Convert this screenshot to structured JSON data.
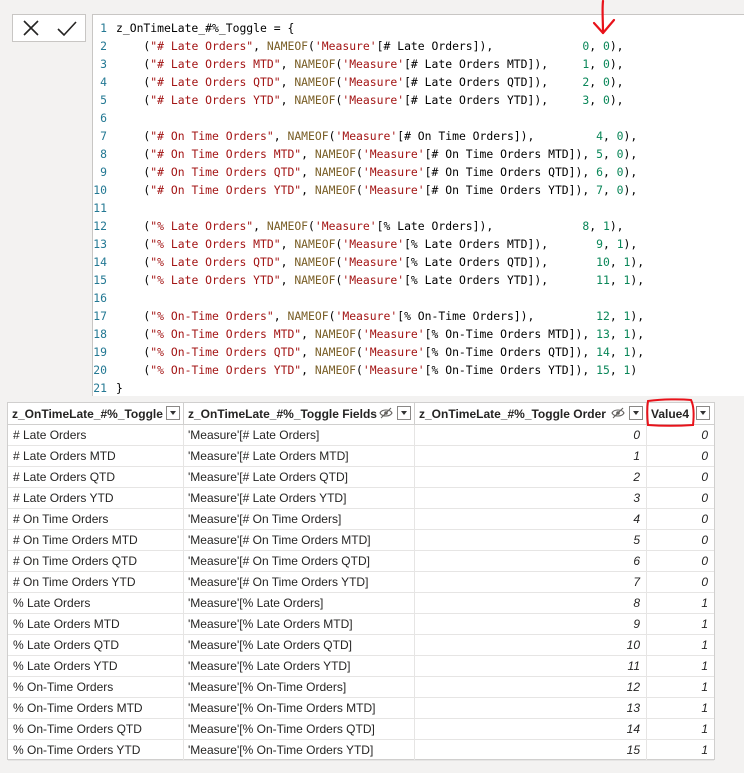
{
  "editor": {
    "lines": [
      {
        "n": "1",
        "segs": [
          [
            "kw",
            "z_OnTimeLate_#%_Toggle = {"
          ]
        ]
      },
      {
        "n": "2",
        "segs": [
          [
            "kw",
            "    ("
          ],
          [
            "str",
            "\"# Late Orders\""
          ],
          [
            "kw",
            ", "
          ],
          [
            "fn",
            "NAMEOF"
          ],
          [
            "kw",
            "("
          ],
          [
            "str",
            "'Measure'"
          ],
          [
            "kw",
            "[# Late Orders]),             "
          ],
          [
            "num",
            "0"
          ],
          [
            "kw",
            ", "
          ],
          [
            "num",
            "0"
          ],
          [
            "kw",
            "),"
          ]
        ]
      },
      {
        "n": "3",
        "segs": [
          [
            "kw",
            "    ("
          ],
          [
            "str",
            "\"# Late Orders MTD\""
          ],
          [
            "kw",
            ", "
          ],
          [
            "fn",
            "NAMEOF"
          ],
          [
            "kw",
            "("
          ],
          [
            "str",
            "'Measure'"
          ],
          [
            "kw",
            "[# Late Orders MTD]),     "
          ],
          [
            "num",
            "1"
          ],
          [
            "kw",
            ", "
          ],
          [
            "num",
            "0"
          ],
          [
            "kw",
            "),"
          ]
        ]
      },
      {
        "n": "4",
        "segs": [
          [
            "kw",
            "    ("
          ],
          [
            "str",
            "\"# Late Orders QTD\""
          ],
          [
            "kw",
            ", "
          ],
          [
            "fn",
            "NAMEOF"
          ],
          [
            "kw",
            "("
          ],
          [
            "str",
            "'Measure'"
          ],
          [
            "kw",
            "[# Late Orders QTD]),     "
          ],
          [
            "num",
            "2"
          ],
          [
            "kw",
            ", "
          ],
          [
            "num",
            "0"
          ],
          [
            "kw",
            "),"
          ]
        ]
      },
      {
        "n": "5",
        "segs": [
          [
            "kw",
            "    ("
          ],
          [
            "str",
            "\"# Late Orders YTD\""
          ],
          [
            "kw",
            ", "
          ],
          [
            "fn",
            "NAMEOF"
          ],
          [
            "kw",
            "("
          ],
          [
            "str",
            "'Measure'"
          ],
          [
            "kw",
            "[# Late Orders YTD]),     "
          ],
          [
            "num",
            "3"
          ],
          [
            "kw",
            ", "
          ],
          [
            "num",
            "0"
          ],
          [
            "kw",
            "),"
          ]
        ]
      },
      {
        "n": "6",
        "segs": []
      },
      {
        "n": "7",
        "segs": [
          [
            "kw",
            "    ("
          ],
          [
            "str",
            "\"# On Time Orders\""
          ],
          [
            "kw",
            ", "
          ],
          [
            "fn",
            "NAMEOF"
          ],
          [
            "kw",
            "("
          ],
          [
            "str",
            "'Measure'"
          ],
          [
            "kw",
            "[# On Time Orders]),         "
          ],
          [
            "num",
            "4"
          ],
          [
            "kw",
            ", "
          ],
          [
            "num",
            "0"
          ],
          [
            "kw",
            "),"
          ]
        ]
      },
      {
        "n": "8",
        "segs": [
          [
            "kw",
            "    ("
          ],
          [
            "str",
            "\"# On Time Orders MTD\""
          ],
          [
            "kw",
            ", "
          ],
          [
            "fn",
            "NAMEOF"
          ],
          [
            "kw",
            "("
          ],
          [
            "str",
            "'Measure'"
          ],
          [
            "kw",
            "[# On Time Orders MTD]), "
          ],
          [
            "num",
            "5"
          ],
          [
            "kw",
            ", "
          ],
          [
            "num",
            "0"
          ],
          [
            "kw",
            "),"
          ]
        ]
      },
      {
        "n": "9",
        "segs": [
          [
            "kw",
            "    ("
          ],
          [
            "str",
            "\"# On Time Orders QTD\""
          ],
          [
            "kw",
            ", "
          ],
          [
            "fn",
            "NAMEOF"
          ],
          [
            "kw",
            "("
          ],
          [
            "str",
            "'Measure'"
          ],
          [
            "kw",
            "[# On Time Orders QTD]), "
          ],
          [
            "num",
            "6"
          ],
          [
            "kw",
            ", "
          ],
          [
            "num",
            "0"
          ],
          [
            "kw",
            "),"
          ]
        ]
      },
      {
        "n": "10",
        "segs": [
          [
            "kw",
            "    ("
          ],
          [
            "str",
            "\"# On Time Orders YTD\""
          ],
          [
            "kw",
            ", "
          ],
          [
            "fn",
            "NAMEOF"
          ],
          [
            "kw",
            "("
          ],
          [
            "str",
            "'Measure'"
          ],
          [
            "kw",
            "[# On Time Orders YTD]), "
          ],
          [
            "num",
            "7"
          ],
          [
            "kw",
            ", "
          ],
          [
            "num",
            "0"
          ],
          [
            "kw",
            "),"
          ]
        ]
      },
      {
        "n": "11",
        "segs": []
      },
      {
        "n": "12",
        "segs": [
          [
            "kw",
            "    ("
          ],
          [
            "str",
            "\"% Late Orders\""
          ],
          [
            "kw",
            ", "
          ],
          [
            "fn",
            "NAMEOF"
          ],
          [
            "kw",
            "("
          ],
          [
            "str",
            "'Measure'"
          ],
          [
            "kw",
            "[% Late Orders]),             "
          ],
          [
            "num",
            "8"
          ],
          [
            "kw",
            ", "
          ],
          [
            "num",
            "1"
          ],
          [
            "kw",
            "),"
          ]
        ]
      },
      {
        "n": "13",
        "segs": [
          [
            "kw",
            "    ("
          ],
          [
            "str",
            "\"% Late Orders MTD\""
          ],
          [
            "kw",
            ", "
          ],
          [
            "fn",
            "NAMEOF"
          ],
          [
            "kw",
            "("
          ],
          [
            "str",
            "'Measure'"
          ],
          [
            "kw",
            "[% Late Orders MTD]),       "
          ],
          [
            "num",
            "9"
          ],
          [
            "kw",
            ", "
          ],
          [
            "num",
            "1"
          ],
          [
            "kw",
            "),"
          ]
        ]
      },
      {
        "n": "14",
        "segs": [
          [
            "kw",
            "    ("
          ],
          [
            "str",
            "\"% Late Orders QTD\""
          ],
          [
            "kw",
            ", "
          ],
          [
            "fn",
            "NAMEOF"
          ],
          [
            "kw",
            "("
          ],
          [
            "str",
            "'Measure'"
          ],
          [
            "kw",
            "[% Late Orders QTD]),       "
          ],
          [
            "num",
            "10"
          ],
          [
            "kw",
            ", "
          ],
          [
            "num",
            "1"
          ],
          [
            "kw",
            "),"
          ]
        ]
      },
      {
        "n": "15",
        "segs": [
          [
            "kw",
            "    ("
          ],
          [
            "str",
            "\"% Late Orders YTD\""
          ],
          [
            "kw",
            ", "
          ],
          [
            "fn",
            "NAMEOF"
          ],
          [
            "kw",
            "("
          ],
          [
            "str",
            "'Measure'"
          ],
          [
            "kw",
            "[% Late Orders YTD]),       "
          ],
          [
            "num",
            "11"
          ],
          [
            "kw",
            ", "
          ],
          [
            "num",
            "1"
          ],
          [
            "kw",
            "),"
          ]
        ]
      },
      {
        "n": "16",
        "segs": []
      },
      {
        "n": "17",
        "segs": [
          [
            "kw",
            "    ("
          ],
          [
            "str",
            "\"% On-Time Orders\""
          ],
          [
            "kw",
            ", "
          ],
          [
            "fn",
            "NAMEOF"
          ],
          [
            "kw",
            "("
          ],
          [
            "str",
            "'Measure'"
          ],
          [
            "kw",
            "[% On-Time Orders]),         "
          ],
          [
            "num",
            "12"
          ],
          [
            "kw",
            ", "
          ],
          [
            "num",
            "1"
          ],
          [
            "kw",
            "),"
          ]
        ]
      },
      {
        "n": "18",
        "segs": [
          [
            "kw",
            "    ("
          ],
          [
            "str",
            "\"% On-Time Orders MTD\""
          ],
          [
            "kw",
            ", "
          ],
          [
            "fn",
            "NAMEOF"
          ],
          [
            "kw",
            "("
          ],
          [
            "str",
            "'Measure'"
          ],
          [
            "kw",
            "[% On-Time Orders MTD]), "
          ],
          [
            "num",
            "13"
          ],
          [
            "kw",
            ", "
          ],
          [
            "num",
            "1"
          ],
          [
            "kw",
            "),"
          ]
        ]
      },
      {
        "n": "19",
        "segs": [
          [
            "kw",
            "    ("
          ],
          [
            "str",
            "\"% On-Time Orders QTD\""
          ],
          [
            "kw",
            ", "
          ],
          [
            "fn",
            "NAMEOF"
          ],
          [
            "kw",
            "("
          ],
          [
            "str",
            "'Measure'"
          ],
          [
            "kw",
            "[% On-Time Orders QTD]), "
          ],
          [
            "num",
            "14"
          ],
          [
            "kw",
            ", "
          ],
          [
            "num",
            "1"
          ],
          [
            "kw",
            "),"
          ]
        ]
      },
      {
        "n": "20",
        "segs": [
          [
            "kw",
            "    ("
          ],
          [
            "str",
            "\"% On-Time Orders YTD\""
          ],
          [
            "kw",
            ", "
          ],
          [
            "fn",
            "NAMEOF"
          ],
          [
            "kw",
            "("
          ],
          [
            "str",
            "'Measure'"
          ],
          [
            "kw",
            "[% On-Time Orders YTD]), "
          ],
          [
            "num",
            "15"
          ],
          [
            "kw",
            ", "
          ],
          [
            "num",
            "1"
          ],
          [
            "kw",
            ")"
          ]
        ]
      },
      {
        "n": "21",
        "segs": [
          [
            "kw",
            "}"
          ]
        ]
      }
    ]
  },
  "icons": {
    "cancel": "close-icon",
    "commit": "checkmark-icon",
    "hidden": "eye-hidden-icon",
    "filter": "chevron-down-icon"
  },
  "colors": {
    "annotation": "#e8121a",
    "line_number": "#237893",
    "string": "#a31515",
    "number": "#098658",
    "function": "#795e26"
  },
  "grid": {
    "columns": [
      {
        "label": "z_OnTimeLate_#%_Toggle",
        "hidden": false
      },
      {
        "label": "z_OnTimeLate_#%_Toggle Fields",
        "hidden": true
      },
      {
        "label": "z_OnTimeLate_#%_Toggle Order",
        "hidden": true
      },
      {
        "label": "Value4",
        "hidden": false
      }
    ],
    "rows": [
      [
        "# Late Orders",
        "'Measure'[# Late Orders]",
        "0",
        "0"
      ],
      [
        "# Late Orders MTD",
        "'Measure'[# Late Orders MTD]",
        "1",
        "0"
      ],
      [
        "# Late Orders QTD",
        "'Measure'[# Late Orders QTD]",
        "2",
        "0"
      ],
      [
        "# Late Orders YTD",
        "'Measure'[# Late Orders YTD]",
        "3",
        "0"
      ],
      [
        "# On Time Orders",
        "'Measure'[# On Time Orders]",
        "4",
        "0"
      ],
      [
        "# On Time Orders MTD",
        "'Measure'[# On Time Orders MTD]",
        "5",
        "0"
      ],
      [
        "# On Time Orders QTD",
        "'Measure'[# On Time Orders QTD]",
        "6",
        "0"
      ],
      [
        "# On Time Orders YTD",
        "'Measure'[# On Time Orders YTD]",
        "7",
        "0"
      ],
      [
        "% Late Orders",
        "'Measure'[% Late Orders]",
        "8",
        "1"
      ],
      [
        "% Late Orders MTD",
        "'Measure'[% Late Orders MTD]",
        "9",
        "1"
      ],
      [
        "% Late Orders QTD",
        "'Measure'[% Late Orders QTD]",
        "10",
        "1"
      ],
      [
        "% Late Orders YTD",
        "'Measure'[% Late Orders YTD]",
        "11",
        "1"
      ],
      [
        "% On-Time Orders",
        "'Measure'[% On-Time Orders]",
        "12",
        "1"
      ],
      [
        "% On-Time Orders MTD",
        "'Measure'[% On-Time Orders MTD]",
        "13",
        "1"
      ],
      [
        "% On-Time Orders QTD",
        "'Measure'[% On-Time Orders QTD]",
        "14",
        "1"
      ],
      [
        "% On-Time Orders YTD",
        "'Measure'[% On-Time Orders YTD]",
        "15",
        "1"
      ]
    ]
  }
}
